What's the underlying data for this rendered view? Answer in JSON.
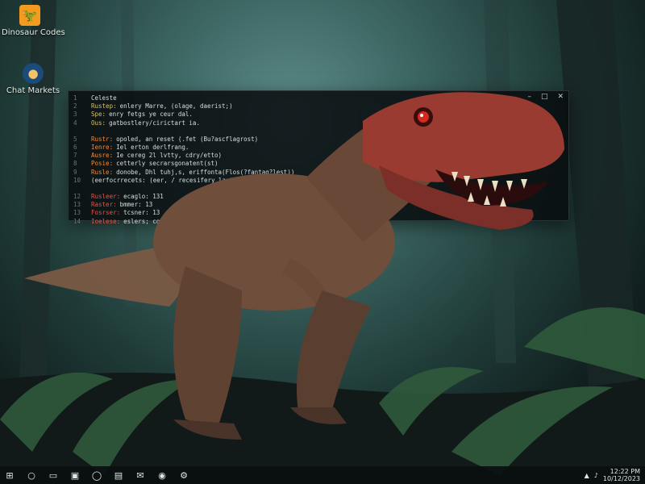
{
  "desktop": {
    "icons": [
      {
        "label": "Dinosaur Codes",
        "icon": "dinosaur-app-icon"
      },
      {
        "label": "Chat Markets",
        "icon": "chat-app-icon"
      }
    ]
  },
  "terminal": {
    "controls": {
      "minimize": "–",
      "maximize": "□",
      "close": "✕"
    },
    "lines": [
      {
        "num": "1",
        "kw": "",
        "text": "Celeste"
      },
      {
        "num": "2",
        "kw": "Rustep:",
        "text": "enlery Marre, (olage, daerist;)"
      },
      {
        "num": "3",
        "kw": "Spe:",
        "text": "enry fetgs ye ceur dal."
      },
      {
        "num": "4",
        "kw": "Ous:",
        "text": "gatbostlery/cirictart ia."
      },
      {
        "num": "",
        "kw": "",
        "text": ""
      },
      {
        "num": "5",
        "kw": "Rustr:",
        "text": "opoled, an reset (.fet (Bu?ascflagrost)"
      },
      {
        "num": "6",
        "kw": "Ienre:",
        "text": "Iel erton derlfrang."
      },
      {
        "num": "7",
        "kw": "Ausre:",
        "text": "Ie cereg 2l lvtty, cdry/etto)"
      },
      {
        "num": "8",
        "kw": "Posie:",
        "text": "cetterly secrarsgonatent(st)"
      },
      {
        "num": "9",
        "kw": "Rusle:",
        "text": "donobe, Dhl tuhj,s, eriffonta(Flos(?fantag?lest))"
      },
      {
        "num": "10",
        "kw": "",
        "text": "(eerfocrrecets: (eer, / recesifery laot)ff"
      },
      {
        "num": "",
        "kw": "",
        "text": ""
      },
      {
        "num": "12",
        "kw": "Rusleer:",
        "text": "ecaglo: 131"
      },
      {
        "num": "13",
        "kw": "Raster:",
        "text": "bmmer: 13"
      },
      {
        "num": "13",
        "kw": "Fosrser:",
        "text": "tcsner: 13"
      },
      {
        "num": "14",
        "kw": "Ioelese:",
        "text": "eslers; colterf/effects)"
      }
    ]
  },
  "taskbar": {
    "buttons": [
      {
        "name": "start-button",
        "glyph": "⊞"
      },
      {
        "name": "search-button",
        "glyph": "○"
      },
      {
        "name": "file-explorer-button",
        "glyph": "▭"
      },
      {
        "name": "store-button",
        "glyph": "▣"
      },
      {
        "name": "opera-button",
        "glyph": "◯"
      },
      {
        "name": "terminal-button",
        "glyph": "▤"
      },
      {
        "name": "mail-button",
        "glyph": "✉"
      },
      {
        "name": "chrome-button",
        "glyph": "◉"
      },
      {
        "name": "settings-button",
        "glyph": "⚙"
      }
    ],
    "tray": {
      "time": "12:22 PM",
      "date": "10/12/2023"
    }
  },
  "colors": {
    "accent": "#f39b1e",
    "keyword": "#d6c36b",
    "keyword_red": "#e0564a",
    "terminal_bg": "#080c0e"
  }
}
